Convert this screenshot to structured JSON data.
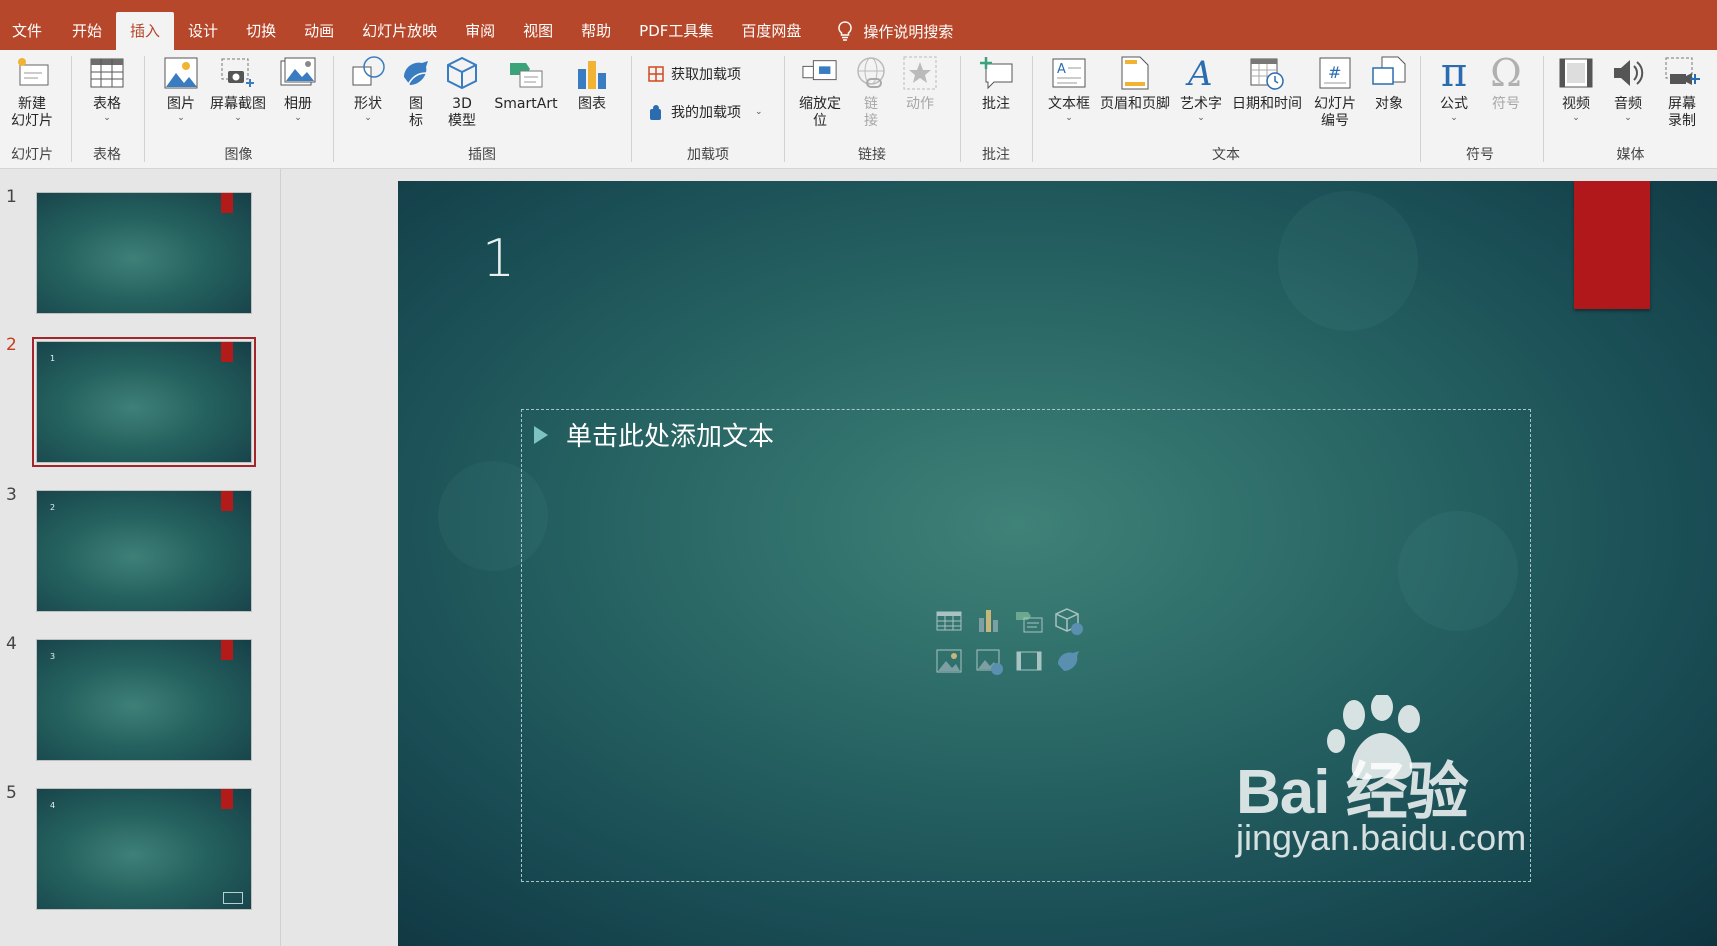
{
  "tabs": [
    {
      "label": "文件",
      "active": false
    },
    {
      "label": "开始",
      "active": false
    },
    {
      "label": "插入",
      "active": true
    },
    {
      "label": "设计",
      "active": false
    },
    {
      "label": "切换",
      "active": false
    },
    {
      "label": "动画",
      "active": false
    },
    {
      "label": "幻灯片放映",
      "active": false
    },
    {
      "label": "审阅",
      "active": false
    },
    {
      "label": "视图",
      "active": false
    },
    {
      "label": "帮助",
      "active": false
    },
    {
      "label": "PDF工具集",
      "active": false
    },
    {
      "label": "百度网盘",
      "active": false
    }
  ],
  "tell_me": "操作说明搜索",
  "ribbon": {
    "slides": {
      "group": "幻灯片",
      "new_slide": "新建\n幻灯片"
    },
    "tables": {
      "group": "表格",
      "table": "表格"
    },
    "images": {
      "group": "图像",
      "picture": "图片",
      "screenshot": "屏幕截图",
      "album": "相册"
    },
    "illustrations": {
      "group": "插图",
      "shapes": "形状",
      "icons": "图\n标",
      "model3d": "3D\n模型",
      "smartart": "SmartArt",
      "chart": "图表"
    },
    "addins": {
      "group": "加载项",
      "get": "获取加载项",
      "my": "我的加载项"
    },
    "links": {
      "group": "链接",
      "zoom": "缩放定\n位",
      "link": "链\n接",
      "action": "动作"
    },
    "comments": {
      "group": "批注",
      "comment": "批注"
    },
    "text": {
      "group": "文本",
      "textbox": "文本框",
      "header_footer": "页眉和页脚",
      "wordart": "艺术字",
      "datetime": "日期和时间",
      "slide_number": "幻灯片\n编号",
      "object": "对象"
    },
    "symbols": {
      "group": "符号",
      "equation": "公式",
      "symbol": "符号"
    },
    "media": {
      "group": "媒体",
      "video": "视频",
      "audio": "音频",
      "screen_recording": "屏幕\n录制"
    }
  },
  "thumbnails": [
    {
      "num": "1",
      "label": "",
      "selected": false,
      "has_box": false
    },
    {
      "num": "2",
      "label": "1",
      "selected": true,
      "has_box": false
    },
    {
      "num": "3",
      "label": "2",
      "selected": false,
      "has_box": false
    },
    {
      "num": "4",
      "label": "3",
      "selected": false,
      "has_box": false
    },
    {
      "num": "5",
      "label": "4",
      "selected": false,
      "has_box": true
    }
  ],
  "slide": {
    "number": "1",
    "placeholder": "单击此处添加文本"
  },
  "watermark": {
    "brand": "Bai  经验",
    "url": "jingyan.baidu.com"
  },
  "colors": {
    "accent": "#b7472a",
    "slide_flag": "#b0181b",
    "selected_outline": "#a3262a"
  }
}
